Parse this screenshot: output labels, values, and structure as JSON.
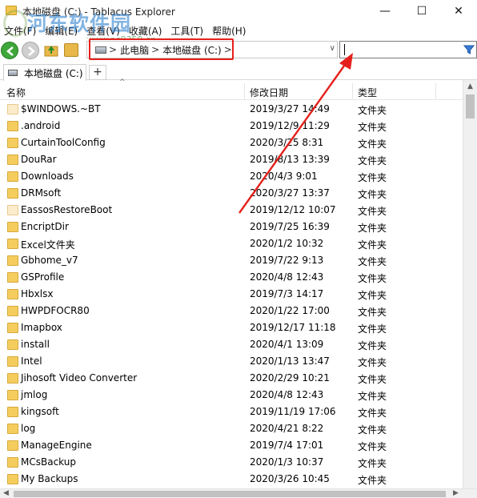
{
  "window": {
    "title": "本地磁盘 (C:) - Tablacus Explorer",
    "minimize_glyph": "—",
    "maximize_glyph": "☐",
    "close_glyph": "✕"
  },
  "watermark": {
    "main": "河东软件园",
    "sub": "www.pc0359.cn"
  },
  "menu": {
    "items": [
      "文件(F)",
      "编辑(E)",
      "查看(V)",
      "收藏(A)",
      "工具(T)",
      "帮助(H)"
    ]
  },
  "address": {
    "separator": ">",
    "crumbs": [
      "此电脑",
      "本地磁盘 (C:)"
    ],
    "dropdown_glyph": "∨"
  },
  "search": {
    "value": "",
    "icon": "filter-icon"
  },
  "tabs": {
    "items": [
      {
        "label": "本地磁盘 (C:)"
      }
    ],
    "add_label": "+"
  },
  "columns": {
    "name": "名称",
    "date": "修改日期",
    "type": "类型"
  },
  "files": [
    {
      "name": "$WINDOWS.~BT",
      "date": "2019/3/27 14:49",
      "type": "文件夹"
    },
    {
      "name": ".android",
      "date": "2019/12/9 11:29",
      "type": "文件夹"
    },
    {
      "name": "CurtainToolConfig",
      "date": "2020/3/25 8:31",
      "type": "文件夹"
    },
    {
      "name": "DouRar",
      "date": "2019/8/13 13:39",
      "type": "文件夹"
    },
    {
      "name": "Downloads",
      "date": "2020/4/3 9:01",
      "type": "文件夹"
    },
    {
      "name": "DRMsoft",
      "date": "2020/3/27 13:37",
      "type": "文件夹"
    },
    {
      "name": "EassosRestoreBoot",
      "date": "2019/12/12 10:07",
      "type": "文件夹"
    },
    {
      "name": "EncriptDir",
      "date": "2019/7/25 16:39",
      "type": "文件夹"
    },
    {
      "name": "Excel文件夹",
      "date": "2020/1/2 10:32",
      "type": "文件夹"
    },
    {
      "name": "Gbhome_v7",
      "date": "2019/7/22 9:13",
      "type": "文件夹"
    },
    {
      "name": "GSProfile",
      "date": "2020/4/8 12:43",
      "type": "文件夹"
    },
    {
      "name": "Hbxlsx",
      "date": "2019/7/3 14:17",
      "type": "文件夹"
    },
    {
      "name": "HWPDFOCR80",
      "date": "2020/1/22 17:00",
      "type": "文件夹"
    },
    {
      "name": "Imapbox",
      "date": "2019/12/17 11:18",
      "type": "文件夹"
    },
    {
      "name": "install",
      "date": "2020/4/1 13:09",
      "type": "文件夹"
    },
    {
      "name": "Intel",
      "date": "2020/1/13 13:47",
      "type": "文件夹"
    },
    {
      "name": "Jihosoft Video Converter",
      "date": "2020/2/29 10:21",
      "type": "文件夹"
    },
    {
      "name": "jmlog",
      "date": "2020/4/8 12:43",
      "type": "文件夹"
    },
    {
      "name": "kingsoft",
      "date": "2019/11/19 17:06",
      "type": "文件夹"
    },
    {
      "name": "log",
      "date": "2020/4/21 8:22",
      "type": "文件夹"
    },
    {
      "name": "ManageEngine",
      "date": "2019/7/4 17:01",
      "type": "文件夹"
    },
    {
      "name": "MCsBackup",
      "date": "2020/1/3 10:37",
      "type": "文件夹"
    },
    {
      "name": "My Backups",
      "date": "2020/3/26 10:45",
      "type": "文件夹"
    }
  ],
  "colors": {
    "highlight": "#e5201b",
    "back_button": "#3fa63a",
    "folder": "#f5cd5e"
  }
}
